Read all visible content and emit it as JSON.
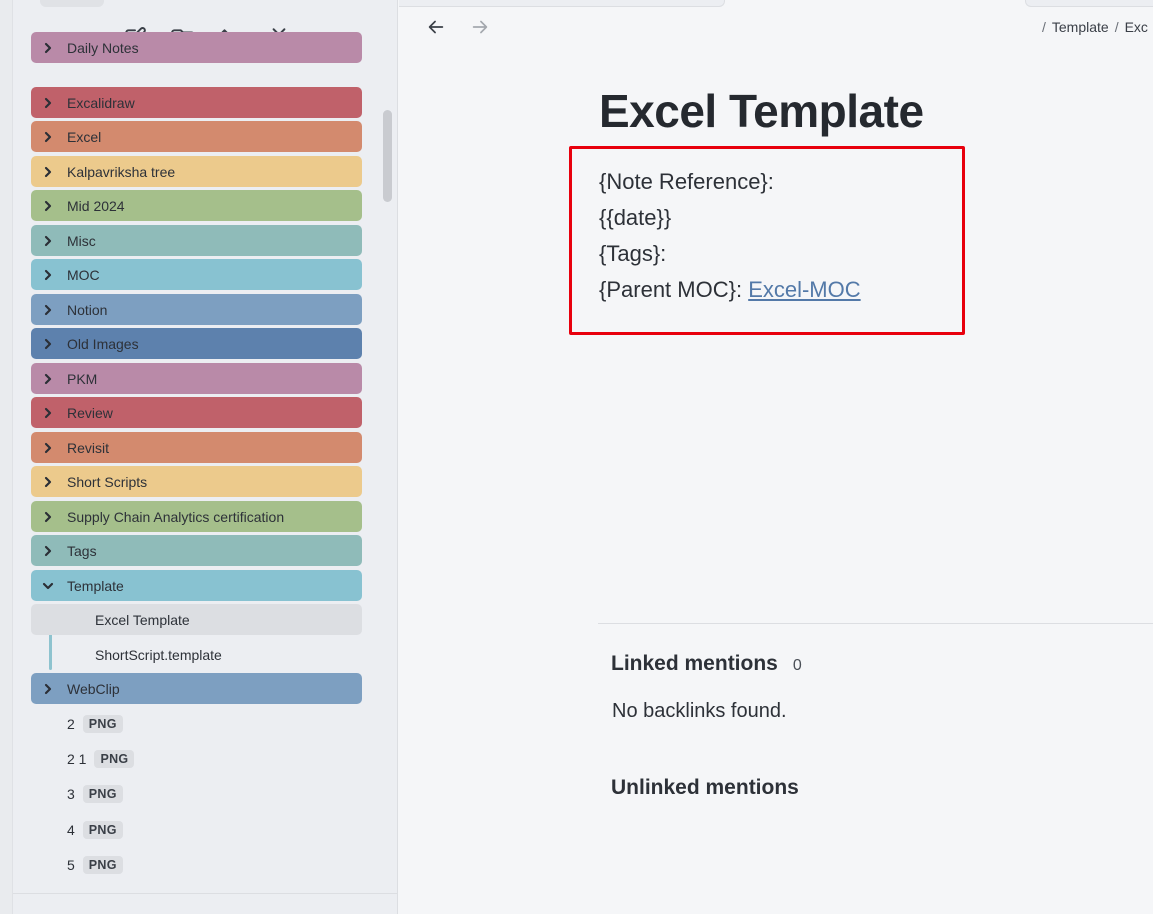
{
  "toolbar": {
    "icons": [
      "new-note-icon",
      "new-folder-icon",
      "sort-icon",
      "collapse-all-icon"
    ]
  },
  "folders": [
    {
      "label": "Daily Notes",
      "color": "#b98aa8"
    },
    {
      "label": "Excalidraw",
      "color": "#c0616a"
    },
    {
      "label": "Excel",
      "color": "#d38a6e"
    },
    {
      "label": "Kalpavriksha tree",
      "color": "#ecca8c"
    },
    {
      "label": "Mid 2024",
      "color": "#a5bf8b"
    },
    {
      "label": "Misc",
      "color": "#8fbbb9"
    },
    {
      "label": "MOC",
      "color": "#88c2d1"
    },
    {
      "label": "Notion",
      "color": "#7d9fc1"
    },
    {
      "label": "Old Images",
      "color": "#5d81ad"
    },
    {
      "label": "PKM",
      "color": "#b98aa8"
    },
    {
      "label": "Review",
      "color": "#c0616a"
    },
    {
      "label": "Revisit",
      "color": "#d38a6e"
    },
    {
      "label": "Short Scripts",
      "color": "#ecca8c"
    },
    {
      "label": "Supply Chain Analytics certification",
      "color": "#a5bf8b"
    },
    {
      "label": "Tags",
      "color": "#8fbbb9"
    },
    {
      "label": "Template",
      "color": "#88c2d1",
      "expanded": true
    },
    {
      "label": "WebClip",
      "color": "#7d9fc1"
    }
  ],
  "template_children": [
    {
      "label": "Excel Template",
      "active": true
    },
    {
      "label": "ShortScript.template",
      "active": false
    }
  ],
  "files": [
    {
      "name": "2",
      "ext": "PNG"
    },
    {
      "name": "2 1",
      "ext": "PNG"
    },
    {
      "name": "3",
      "ext": "PNG"
    },
    {
      "name": "4",
      "ext": "PNG"
    },
    {
      "name": "5",
      "ext": "PNG"
    }
  ],
  "breadcrumb": {
    "folder": "Template",
    "current": "Exc"
  },
  "note": {
    "title": "Excel Template",
    "line1": "{Note Reference}:",
    "line2": "{{date}}",
    "line3": "{Tags}:",
    "line4_prefix": "{Parent MOC}: ",
    "line4_link": "Excel-MOC"
  },
  "backlinks": {
    "linked_title": "Linked mentions",
    "linked_count": "0",
    "empty_text": "No backlinks found.",
    "unlinked_title": "Unlinked mentions"
  },
  "colors": {
    "highlight_box": "#e8000d",
    "link": "#5379a8"
  }
}
